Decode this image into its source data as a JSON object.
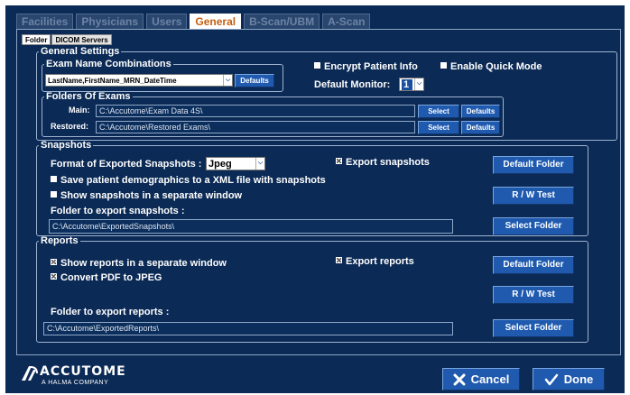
{
  "tabs": [
    "Facilities",
    "Physicians",
    "Users",
    "General",
    "B-Scan/UBM",
    "A-Scan"
  ],
  "active_tab": "General",
  "subtabs": [
    "Folder",
    "DICOM Servers"
  ],
  "general": {
    "legend": "General Settings",
    "exam_legend": "Exam Name Combinations",
    "exam_value": "LastName,FirstName_MRN_DateTime",
    "exam_defaults": "Defaults",
    "encrypt_label": "Encrypt Patient Info",
    "quick_label": "Enable Quick Mode",
    "monitor_label": "Default Monitor:",
    "monitor_value": "1",
    "folders_legend": "Folders Of Exams",
    "main_label": "Main:",
    "main_path": "C:\\Accutome\\Exam Data 4S\\",
    "restored_label": "Restored:",
    "restored_path": "C:\\Accutome\\Restored Exams\\",
    "select": "Select",
    "defaults": "Defaults"
  },
  "snapshots": {
    "legend": "Snapshots",
    "format_label": "Format of Exported Snapshots :",
    "format_value": "Jpeg",
    "export_label": "Export snapshots",
    "demographics_label": "Save patient demographics to a XML file with snapshots",
    "separate_label": "Show snapshots in a separate window",
    "folder_label": "Folder to export snapshots :",
    "folder_path": "C:\\Accutome\\ExportedSnapshots\\",
    "default_folder": "Default Folder",
    "rw_test": "R / W Test",
    "select_folder": "Select Folder"
  },
  "reports": {
    "legend": "Reports",
    "separate_label": "Show reports in a separate window",
    "export_label": "Export reports",
    "pdf_label": "Convert PDF to JPEG",
    "folder_label": "Folder to export reports :",
    "folder_path": "C:\\Accutome\\ExportedReports\\",
    "default_folder": "Default Folder",
    "rw_test": "R / W Test",
    "select_folder": "Select Folder"
  },
  "footer": {
    "brand": "ACCUTOME",
    "tagline": "A HALMA COMPANY",
    "cancel": "Cancel",
    "done": "Done"
  },
  "colors": {
    "background": "#0b2a55",
    "button": "#1f5aaf",
    "active_tab": "#c65e10"
  }
}
